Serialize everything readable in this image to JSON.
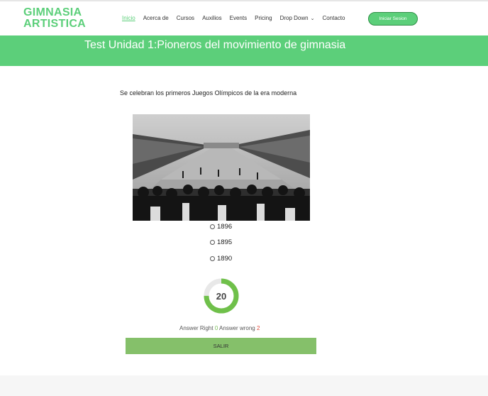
{
  "header": {
    "logo_line1": "GIMNASIA",
    "logo_line2": "ARTISTICA",
    "nav": [
      {
        "label": "Inicio",
        "active": true
      },
      {
        "label": "Acerca de"
      },
      {
        "label": "Cursos"
      },
      {
        "label": "Auxilios"
      },
      {
        "label": "Events"
      },
      {
        "label": "Pricing"
      },
      {
        "label": "Drop Down"
      },
      {
        "label": "Contacto"
      }
    ],
    "login_label": "Iniciar Sesion"
  },
  "banner": {
    "title": "Test Unidad 1:Pioneros del movimiento de gimnasia"
  },
  "quiz": {
    "question": "Se celebran los primeros Juegos Olímpicos de la era moderna",
    "options": [
      "1896",
      "1895",
      "1890"
    ],
    "timer_value": "20",
    "timer_fraction": 0.75,
    "score_right_label": "Answer Right",
    "score_right_value": "0",
    "score_wrong_label": "Answer wrong",
    "score_wrong_value": "2",
    "exit_label": "SALIR"
  },
  "colors": {
    "accent": "#5ccf7a",
    "button": "#85c06a",
    "ring": "#6fc04a",
    "wrong": "#e04a3a"
  }
}
